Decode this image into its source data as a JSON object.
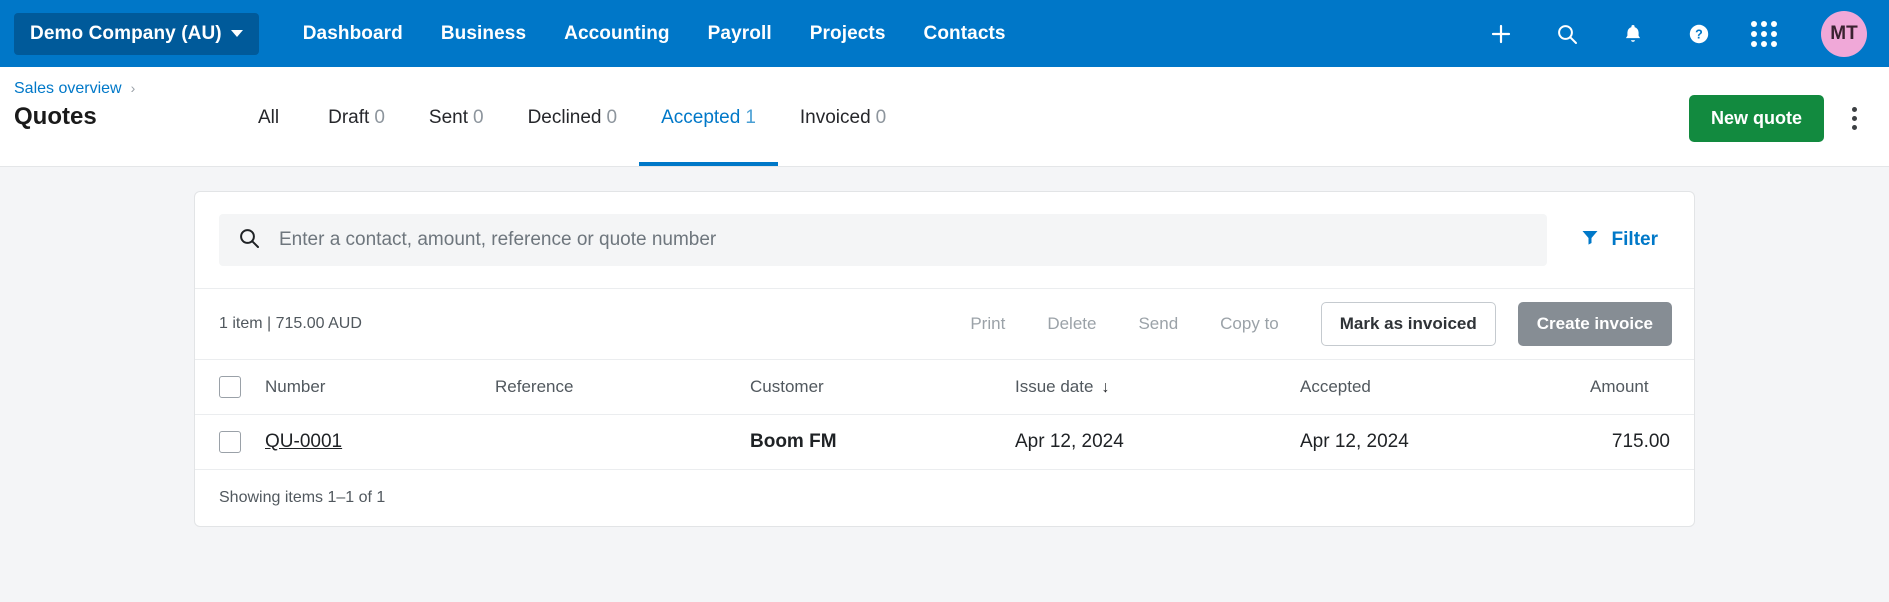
{
  "topnav": {
    "org": {
      "label": "Demo Company (AU)",
      "icon": "chevron-down-icon"
    },
    "links": [
      {
        "label": "Dashboard"
      },
      {
        "label": "Business"
      },
      {
        "label": "Accounting"
      },
      {
        "label": "Payroll"
      },
      {
        "label": "Projects"
      },
      {
        "label": "Contacts"
      }
    ],
    "icons": [
      {
        "name": "plus-icon",
        "glyph": "+"
      },
      {
        "name": "search-icon",
        "glyph": "search"
      },
      {
        "name": "bell-icon",
        "glyph": "bell"
      },
      {
        "name": "help-icon",
        "glyph": "?"
      },
      {
        "name": "apps-grid-icon",
        "glyph": "grid"
      }
    ],
    "avatar": {
      "initials": "MT",
      "color": "#f0a8d8"
    },
    "background": "#0077c8",
    "org_background": "#005a9a"
  },
  "subheader": {
    "breadcrumb": {
      "label": "Sales overview",
      "separator": "›"
    },
    "title": "Quotes",
    "tabs": [
      {
        "label": "All",
        "count": "",
        "active": false
      },
      {
        "label": "Draft",
        "count": "0",
        "active": false
      },
      {
        "label": "Sent",
        "count": "0",
        "active": false
      },
      {
        "label": "Declined",
        "count": "0",
        "active": false
      },
      {
        "label": "Accepted",
        "count": "1",
        "active": true
      },
      {
        "label": "Invoiced",
        "count": "0",
        "active": false
      }
    ],
    "new_quote_label": "New quote",
    "new_quote_color": "#128a3f",
    "kebab_name": "more-options-icon"
  },
  "search": {
    "placeholder": "Enter a contact, amount, reference or quote number",
    "value": "",
    "filter_label": "Filter",
    "filter_color": "#0078c8"
  },
  "toolbar": {
    "summary": "1 item | 715.00 AUD",
    "actions": [
      {
        "label": "Print",
        "disabled": true
      },
      {
        "label": "Delete",
        "disabled": true
      },
      {
        "label": "Send",
        "disabled": true
      },
      {
        "label": "Copy to",
        "disabled": true
      }
    ],
    "mark_invoiced_label": "Mark as invoiced",
    "create_invoice_label": "Create invoice"
  },
  "table": {
    "columns": [
      {
        "key": "number",
        "label": "Number"
      },
      {
        "key": "reference",
        "label": "Reference"
      },
      {
        "key": "customer",
        "label": "Customer"
      },
      {
        "key": "issue_date",
        "label": "Issue date",
        "sorted": "desc",
        "sort_glyph": "↓"
      },
      {
        "key": "accepted",
        "label": "Accepted"
      },
      {
        "key": "amount",
        "label": "Amount"
      }
    ],
    "rows": [
      {
        "number": "QU-0001",
        "reference": "",
        "customer": "Boom FM",
        "issue_date": "Apr 12, 2024",
        "accepted": "Apr 12, 2024",
        "amount": "715.00",
        "selected": false
      }
    ],
    "footer": "Showing items 1–1 of 1"
  }
}
